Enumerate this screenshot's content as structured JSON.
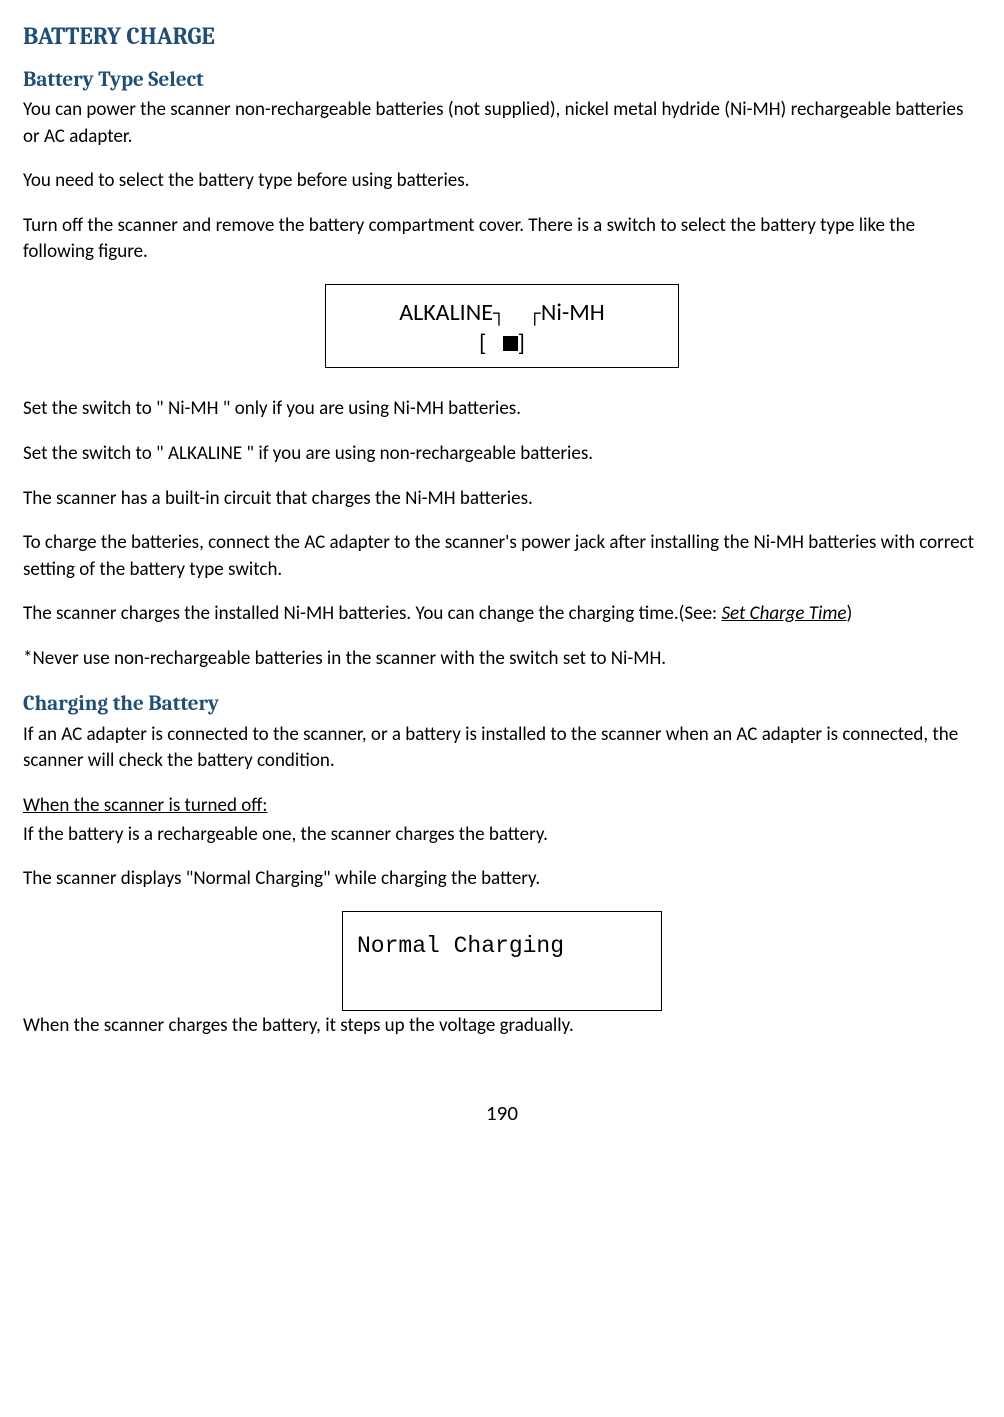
{
  "title": "BATTERY CHARGE",
  "section1": {
    "heading": "Battery Type Select",
    "p1": "You can power the scanner non-rechargeable batteries (not supplied), nickel metal hydride (Ni-MH) rechargeable batteries or AC adapter.",
    "p2": "You need to select the battery type before using batteries.",
    "p3": "Turn off the scanner and remove the battery compartment cover. There is a switch to select the battery type like the following figure.",
    "switch": {
      "left": "ALKALINE",
      "right": "Ni-MH",
      "bracket_left": "[",
      "bracket_right": "]"
    },
    "p4": "Set the switch to \" Ni-MH \" only if you are using Ni-MH batteries.",
    "p5": "Set the switch to \" ALKALINE \" if you are using non-rechargeable batteries.",
    "p6": "The scanner has a built-in circuit that charges the Ni-MH batteries.",
    "p7": "To charge the batteries, connect the AC adapter to the scanner's power jack after installing the Ni-MH batteries with correct setting of the battery type switch.",
    "p8_a": "The scanner charges the installed Ni-MH batteries. You can change the charging time.(See: ",
    "p8_link": "Set Charge Time",
    "p8_b": ")",
    "p9": "*Never use non-rechargeable batteries in the scanner with the switch set to Ni-MH."
  },
  "section2": {
    "heading": "Charging the Battery",
    "p1": "If an AC adapter is connected to the scanner, or a battery is installed to the scanner when an AC adapter is connected, the scanner will check the battery condition.",
    "sub_u": "When the scanner is turned off:",
    "p2": "If the battery is a rechargeable one, the scanner charges the battery.",
    "p3": "The scanner displays \"Normal Charging\" while charging the battery.",
    "lcd": "Normal Charging",
    "p4": "When the scanner charges the battery, it steps up the voltage gradually."
  },
  "page_number": "190"
}
